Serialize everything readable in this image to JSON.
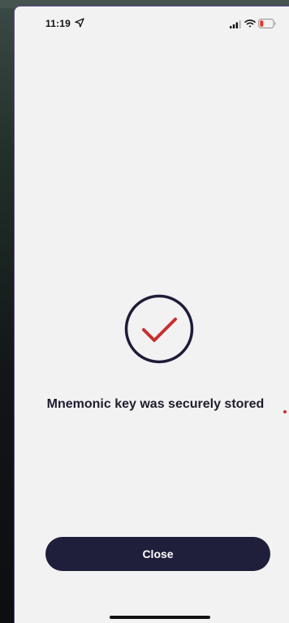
{
  "status_bar": {
    "time": "11:19",
    "icons": [
      "location-arrow-icon",
      "cellular-signal-icon",
      "wifi-icon",
      "battery-low-icon"
    ]
  },
  "main": {
    "status_icon": "check-circle-icon",
    "message": "Mnemonic key was securely stored"
  },
  "actions": {
    "close_label": "Close"
  },
  "colors": {
    "background": "#f3f2f2",
    "primary": "#1f1e3b",
    "accent": "#c62f2f",
    "text": "#1d1d2e"
  }
}
